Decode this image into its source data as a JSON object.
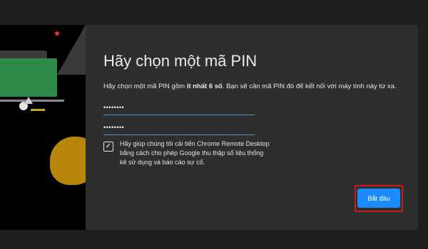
{
  "dialog": {
    "title": "Hãy chọn một mã PIN",
    "description_before": "Hãy chọn một mã PIN gồm ",
    "description_bold": "ít nhất 6 số",
    "description_after": ". Bạn sẽ cần mã PIN đó để kết nối với máy tính này từ xa.",
    "pin_value": "••••••••",
    "pin_confirm_value": "••••••••",
    "checkbox_checked": true,
    "checkbox_mark": "✓",
    "checkbox_label": "Hãy giúp chúng tôi cải tiến Chrome Remote Desktop bằng cách cho phép Google thu thập số liệu thống kê sử dụng và báo cáo sự cố.",
    "start_button": "Bắt đầu"
  },
  "colors": {
    "background": "#1f1f1f",
    "dialog": "#2e2e2e",
    "accent": "#1a8cff",
    "highlight": "#d01818"
  }
}
